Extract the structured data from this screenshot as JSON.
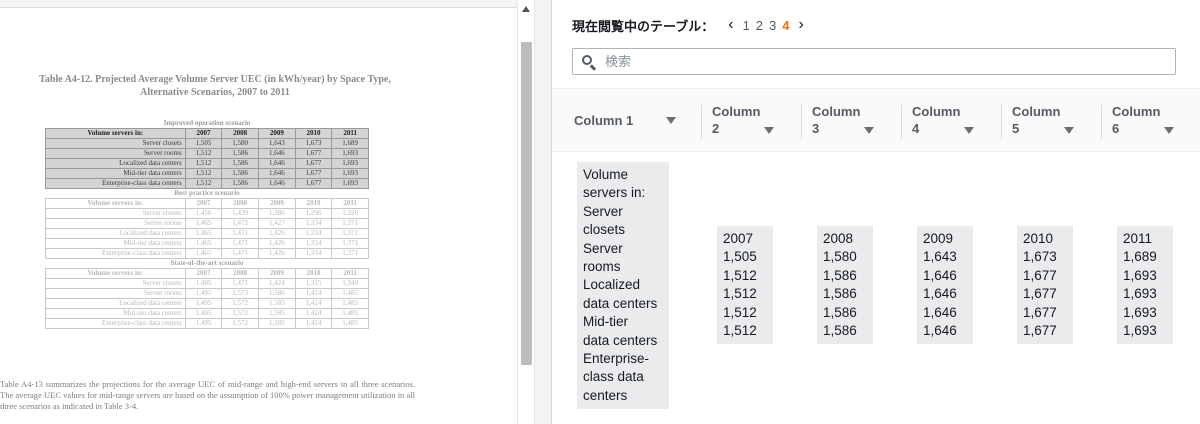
{
  "document": {
    "caption_line1": "Table A4-12.  Projected Average Volume Server UEC (in kWh/year) by Space Type,",
    "caption_line2": "Alternative Scenarios, 2007 to 2011",
    "scenarios": [
      {
        "title": "Improved operation scenario",
        "header": [
          "Volume servers in:",
          "2007",
          "2008",
          "2009",
          "2010",
          "2011"
        ],
        "rows": [
          [
            "Server closets",
            "1,505",
            "1,580",
            "1,643",
            "1,673",
            "1,689"
          ],
          [
            "Server rooms",
            "1,512",
            "1,586",
            "1,646",
            "1,677",
            "1,693"
          ],
          [
            "Localized data centers",
            "1,512",
            "1,586",
            "1,646",
            "1,677",
            "1,693"
          ],
          [
            "Mid-tier data centers",
            "1,512",
            "1,586",
            "1,646",
            "1,677",
            "1,693"
          ],
          [
            "Enterprise-class data centers",
            "1,512",
            "1,586",
            "1,646",
            "1,677",
            "1,693"
          ]
        ]
      },
      {
        "title": "Best practice scenario",
        "header": [
          "Volume servers in:",
          "2007",
          "2008",
          "2009",
          "2010",
          "2011"
        ],
        "rows": [
          [
            "Server closets",
            "1,456",
            "1,439",
            "1,386",
            "1,296",
            "1,326"
          ],
          [
            "Server rooms",
            "1,465",
            "1,472",
            "1,427",
            "1,334",
            "1,371"
          ],
          [
            "Localized data centers",
            "1,465",
            "1,471",
            "1,426",
            "1,334",
            "1,371"
          ],
          [
            "Mid-tier data centers",
            "1,465",
            "1,471",
            "1,426",
            "1,334",
            "1,371"
          ],
          [
            "Enterprise-class data centers",
            "1,465",
            "1,471",
            "1,426",
            "1,334",
            "1,371"
          ]
        ]
      },
      {
        "title": "State-of-the-art scenario",
        "header": [
          "Volume servers in:",
          "2007",
          "2008",
          "2009",
          "2010",
          "2011"
        ],
        "rows": [
          [
            "Server closets",
            "1,485",
            "1,471",
            "1,424",
            "1,315",
            "1,349"
          ],
          [
            "Server rooms",
            "1,495",
            "1,573",
            "1,586",
            "1,424",
            "1,485"
          ],
          [
            "Localized data centers",
            "1,495",
            "1,572",
            "1,585",
            "1,424",
            "1,485"
          ],
          [
            "Mid-tier data centers",
            "1,495",
            "1,572",
            "1,585",
            "1,424",
            "1,485"
          ],
          [
            "Enterprise-class data centers",
            "1,495",
            "1,572",
            "1,585",
            "1,424",
            "1,485"
          ]
        ]
      }
    ],
    "paragraph": "Table A4-13 summarizes the projections for the average UEC of mid-range and high-end servers in all three scenarios.  The average UEC values for mid-range servers are based on the assumption of 100% power management utilization in all three scenarios as indicated in Table 3-4."
  },
  "tables_panel": {
    "label": "現在閲覧中のテーブル：",
    "prev_icon": "chevron-left-icon",
    "next_icon": "chevron-right-icon",
    "pages": [
      "1",
      "2",
      "3",
      "4"
    ],
    "current_page": "4",
    "accent_color": "#ec7211"
  },
  "search": {
    "placeholder": "検索",
    "value": "",
    "icon": "search-icon"
  },
  "grid": {
    "columns": [
      {
        "name": "Column 1"
      },
      {
        "name": "Column\n2"
      },
      {
        "name": "Column\n3"
      },
      {
        "name": "Column\n4"
      },
      {
        "name": "Column\n5"
      },
      {
        "name": "Column\n6"
      }
    ],
    "cells": [
      "Volume\nservers in:\nServer\nclosets\nServer\nrooms\nLocalized\ndata centers\nMid-tier\ndata centers\nEnterprise-\nclass data\ncenters",
      "2007\n1,505\n1,512\n1,512\n1,512\n1,512",
      "2008\n1,580\n1,586\n1,586\n1,586\n1,586",
      "2009\n1,643\n1,646\n1,646\n1,646\n1,646",
      "2010\n1,673\n1,677\n1,677\n1,677\n1,677",
      "2011\n1,689\n1,693\n1,693\n1,693\n1,693"
    ],
    "sort_icon": "caret-down-icon"
  }
}
